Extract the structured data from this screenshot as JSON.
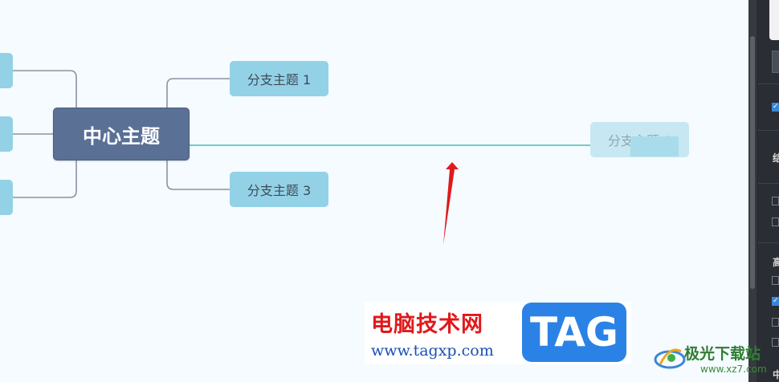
{
  "mindmap": {
    "central_topic": "中心主题",
    "branches": [
      {
        "label": "分支主题 1"
      },
      {
        "label": "分支主题 2"
      },
      {
        "label": "分支主题 3"
      }
    ]
  },
  "watermark": {
    "title": "电脑技术网",
    "url": "www.tagxp.com",
    "tag": "TAG"
  },
  "corner_logo": {
    "name": "极光下载站",
    "url": "www.xz7.com"
  },
  "panel": {
    "labels": [
      "结",
      "高",
      "中"
    ],
    "checkboxes": [
      true,
      false,
      false,
      false,
      false,
      true,
      false,
      false
    ]
  },
  "colors": {
    "canvas": "#f5fbfe",
    "central": "#5a7095",
    "branch": "#93d1e6",
    "drag_line": "#3fc0b0",
    "arrow": "#e0191b",
    "panel": "#2a2d33"
  }
}
